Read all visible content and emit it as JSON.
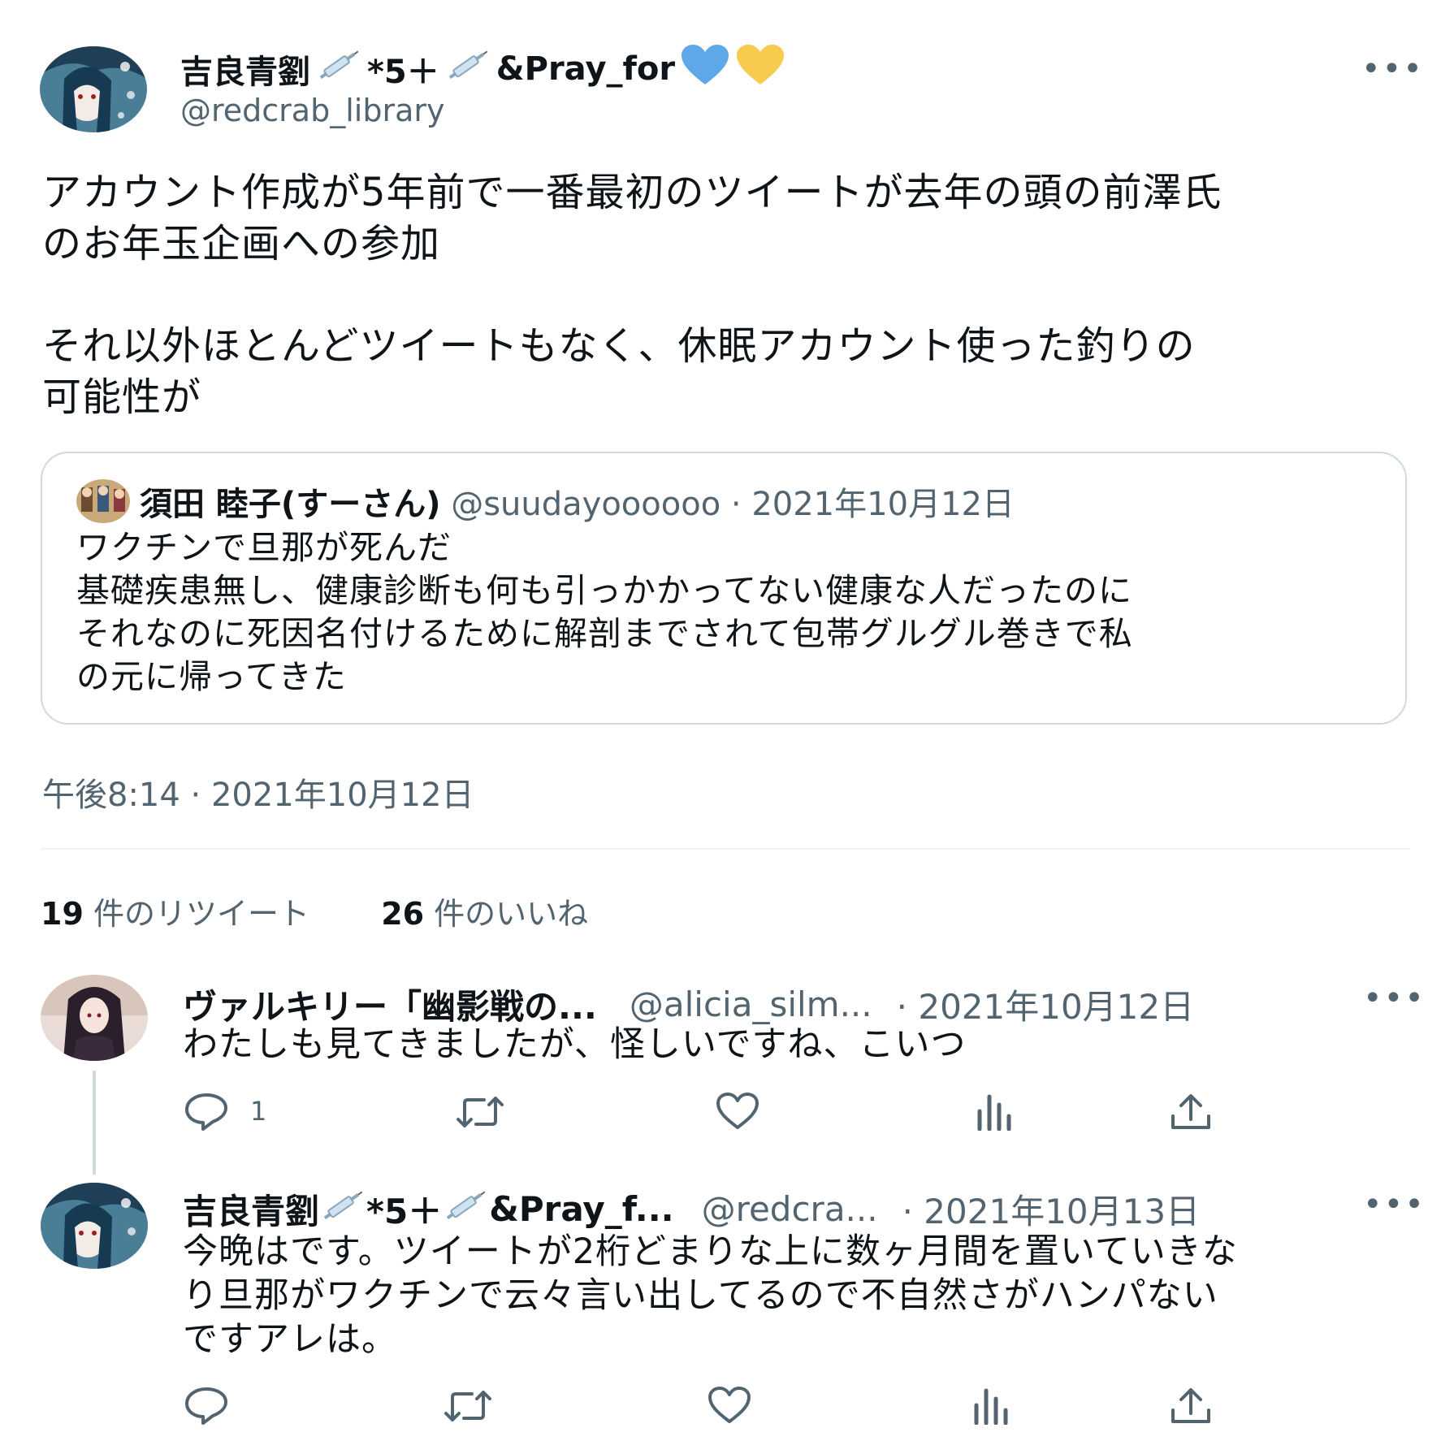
{
  "main_tweet": {
    "display_name": "吉良青劉",
    "name_suffix_1": "*5＋",
    "name_suffix_2": "&Pray_for",
    "handle": "@redcrab_library",
    "more_label": "•••",
    "text": "アカウント作成が5年前で一番最初のツイートが去年の頭の前澤氏\nのお年玉企画への参加\n\nそれ以外ほとんどツイートもなく、休眠アカウント使った釣りの\n可能性が",
    "timestamp": "午後8:14 · 2021年10月12日"
  },
  "quoted_tweet": {
    "display_name": "須田 睦子(すーさん)",
    "handle": "@suudayoooooo",
    "date": "· 2021年10月12日",
    "text": "ワクチンで旦那が死んだ\n基礎疾患無し、健康診断も何も引っかかってない健康な人だったのに\nそれなのに死因名付けるために解剖までされて包帯グルグル巻きで私\nの元に帰ってきた"
  },
  "stats": {
    "retweets_count": "19",
    "retweets_label": "件のリツイート",
    "likes_count": "26",
    "likes_label": "件のいいね"
  },
  "replies": [
    {
      "display_name": "ヴァルキリー「幽影戦の...",
      "handle": "@alicia_silm...",
      "date": "· 2021年10月12日",
      "text": "わたしも見てきましたが、怪しいですね、こいつ",
      "reply_count": "1",
      "more_label": "•••"
    },
    {
      "display_name": "吉良青劉",
      "name_suffix_1": "*5＋",
      "name_suffix_2": "&Pray_f...",
      "handle": "@redcra...",
      "date": "· 2021年10月13日",
      "text": "今晩はです。ツイートが2桁どまりな上に数ヶ月間を置いていきな\nり旦那がワクチンで云々言い出してるので不自然さがハンパない\nですアレは。",
      "reply_count": "",
      "more_label": "•••"
    }
  ],
  "icons": [
    "syringe-icon",
    "blue-heart-icon",
    "yellow-heart-icon",
    "reply-icon",
    "retweet-icon",
    "like-icon",
    "views-icon",
    "share-icon"
  ],
  "colors": {
    "text": "#0f1419",
    "muted": "#536471",
    "border": "#cfd9de",
    "blue_heart": "#5fa8e8",
    "yellow_heart": "#f7cb4d"
  }
}
